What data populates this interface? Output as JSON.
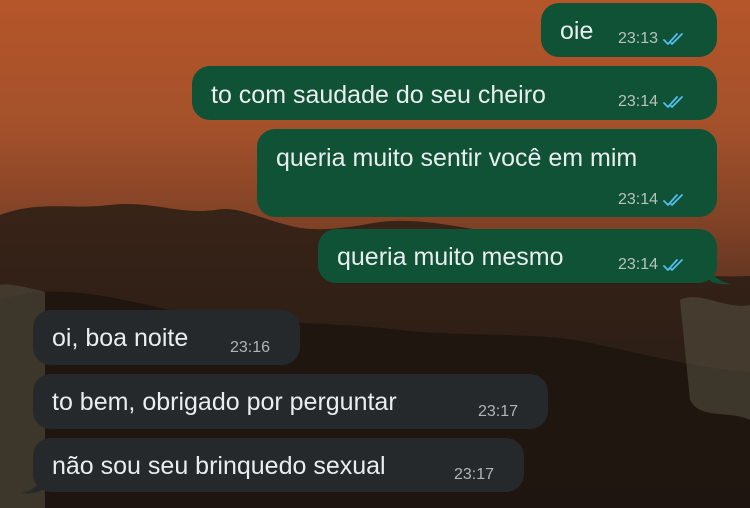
{
  "messages": [
    {
      "direction": "out",
      "text": "oie",
      "time": "23:13",
      "status": "read-double-check-icon"
    },
    {
      "direction": "out",
      "text": "to com saudade do seu cheiro",
      "time": "23:14",
      "status": "read-double-check-icon"
    },
    {
      "direction": "out",
      "text": "queria muito sentir você em mim",
      "time": "23:14",
      "status": "read-double-check-icon"
    },
    {
      "direction": "out",
      "text": "queria muito mesmo",
      "time": "23:14",
      "status": "read-double-check-icon"
    },
    {
      "direction": "in",
      "text": "oi, boa noite",
      "time": "23:16"
    },
    {
      "direction": "in",
      "text": "to bem, obrigado por perguntar",
      "time": "23:17"
    },
    {
      "direction": "in",
      "text": "não sou seu brinquedo sexual",
      "time": "23:17"
    }
  ],
  "colors": {
    "outgoing_bubble": "#0f5236",
    "incoming_bubble": "#25292b",
    "read_ticks": "#53bdeb",
    "wallpaper_sky": "#b5552a"
  }
}
